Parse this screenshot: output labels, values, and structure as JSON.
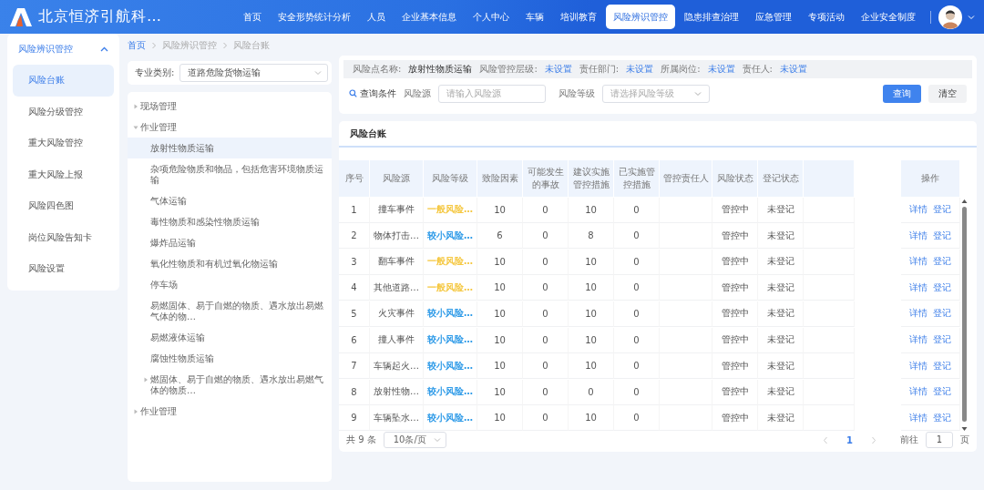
{
  "header": {
    "title": "北京恒济引航科…",
    "nav": [
      {
        "label": "首页",
        "selected": false
      },
      {
        "label": "安全形势统计分析",
        "selected": false
      },
      {
        "label": "人员",
        "selected": false
      },
      {
        "label": "企业基本信息",
        "selected": false
      },
      {
        "label": "个人中心",
        "selected": false
      },
      {
        "label": "车辆",
        "selected": false
      },
      {
        "label": "培训教育",
        "selected": false
      },
      {
        "label": "风险辨识管控",
        "selected": true
      },
      {
        "label": "隐患排查治理",
        "selected": false
      },
      {
        "label": "应急管理",
        "selected": false
      },
      {
        "label": "专项活动",
        "selected": false
      },
      {
        "label": "企业安全制度",
        "selected": false
      }
    ]
  },
  "sidebar": {
    "group": {
      "label": "风险辨识管控",
      "expanded": true
    },
    "items": [
      {
        "label": "风险台账",
        "selected": true
      },
      {
        "label": "风险分级管控",
        "selected": false
      },
      {
        "label": "重大风险管控",
        "selected": false
      },
      {
        "label": "重大风险上报",
        "selected": false
      },
      {
        "label": "风险四色图",
        "selected": false
      },
      {
        "label": "岗位风险告知卡",
        "selected": false
      },
      {
        "label": "风险设置",
        "selected": false
      }
    ]
  },
  "breadcrumb": [
    "首页",
    "风险辨识管控",
    "风险台账"
  ],
  "category": {
    "label": "专业类别:",
    "value": "道路危险货物运输"
  },
  "tree": [
    {
      "label": "现场管理",
      "expanded": false,
      "selected": false
    },
    {
      "label": "作业管理",
      "expanded": true,
      "selected": false,
      "children": [
        {
          "label": "放射性物质运输",
          "selected": true
        },
        {
          "label": "杂项危险物质和物品，包括危害环境物质运输",
          "selected": false
        },
        {
          "label": "气体运输",
          "selected": false
        },
        {
          "label": "毒性物质和感染性物质运输",
          "selected": false
        },
        {
          "label": "爆炸品运输",
          "selected": false
        },
        {
          "label": "氧化性物质和有机过氧化物运输",
          "selected": false
        },
        {
          "label": "停车场",
          "selected": false
        },
        {
          "label": "易燃固体、易于自燃的物质、遇水放出易燃气体的物…",
          "selected": false
        },
        {
          "label": "易燃液体运输",
          "selected": false
        },
        {
          "label": "腐蚀性物质运输",
          "selected": false
        },
        {
          "label": "燃固体、易于自燃的物质、遇水放出易燃气体的物质…",
          "expanded": false,
          "selected": false
        }
      ]
    },
    {
      "label": "作业管理",
      "expanded": false,
      "selected": false
    }
  ],
  "risk_point": [
    {
      "label": "风险点名称:",
      "value": "放射性物质运输",
      "kind": "plain"
    },
    {
      "label": "风险管控层级:",
      "value": "未设置",
      "kind": "unset"
    },
    {
      "label": "责任部门:",
      "value": "未设置",
      "kind": "unset"
    },
    {
      "label": "所属岗位:",
      "value": "未设置",
      "kind": "unset"
    },
    {
      "label": "责任人:",
      "value": "未设置",
      "kind": "unset"
    }
  ],
  "query": {
    "title": "查询条件",
    "fields": [
      {
        "label": "风险源",
        "placeholder": "请输入风险源",
        "kind": "input"
      },
      {
        "label": "风险等级",
        "placeholder": "请选择风险等级",
        "kind": "select"
      }
    ],
    "buttons": [
      {
        "label": "查询",
        "kind": "primary"
      },
      {
        "label": "清空",
        "kind": "default"
      }
    ]
  },
  "ledger": {
    "title": "风险台账",
    "columns": [
      "序号",
      "风险源",
      "风险等级",
      "致险因素",
      "可能发生的事故",
      "建议实施管控措施",
      "已实施管控措施",
      "管控责任人",
      "风险状态",
      "登记状态",
      "操作"
    ],
    "rows": [
      {
        "index": "1",
        "source": "撞车事件",
        "level": {
          "text": "一般风险…",
          "color": "#f5c842"
        },
        "factors": "10",
        "accidents": "0",
        "suggested": "10",
        "implemented": "0",
        "status": "管控中",
        "registered": "未登记",
        "actions": [
          "详情",
          "登记"
        ]
      },
      {
        "index": "2",
        "source": "物体打击…",
        "level": {
          "text": "较小风险…",
          "color": "#2f9be8"
        },
        "factors": "6",
        "accidents": "0",
        "suggested": "8",
        "implemented": "0",
        "status": "管控中",
        "registered": "未登记",
        "actions": [
          "详情",
          "登记"
        ]
      },
      {
        "index": "3",
        "source": "翻车事件",
        "level": {
          "text": "一般风险…",
          "color": "#f5c842"
        },
        "factors": "10",
        "accidents": "0",
        "suggested": "10",
        "implemented": "0",
        "status": "管控中",
        "registered": "未登记",
        "actions": [
          "详情",
          "登记"
        ]
      },
      {
        "index": "4",
        "source": "其他道路…",
        "level": {
          "text": "一般风险…",
          "color": "#f5c842"
        },
        "factors": "10",
        "accidents": "0",
        "suggested": "10",
        "implemented": "0",
        "status": "管控中",
        "registered": "未登记",
        "actions": [
          "详情",
          "登记"
        ]
      },
      {
        "index": "5",
        "source": "火灾事件",
        "level": {
          "text": "较小风险…",
          "color": "#2f9be8"
        },
        "factors": "10",
        "accidents": "0",
        "suggested": "10",
        "implemented": "0",
        "status": "管控中",
        "registered": "未登记",
        "actions": [
          "详情",
          "登记"
        ]
      },
      {
        "index": "6",
        "source": "撞人事件",
        "level": {
          "text": "较小风险…",
          "color": "#2f9be8"
        },
        "factors": "10",
        "accidents": "0",
        "suggested": "10",
        "implemented": "0",
        "status": "管控中",
        "registered": "未登记",
        "actions": [
          "详情",
          "登记"
        ]
      },
      {
        "index": "7",
        "source": "车辆起火…",
        "level": {
          "text": "较小风险…",
          "color": "#2f9be8"
        },
        "factors": "10",
        "accidents": "0",
        "suggested": "10",
        "implemented": "0",
        "status": "管控中",
        "registered": "未登记",
        "actions": [
          "详情",
          "登记"
        ]
      },
      {
        "index": "8",
        "source": "放射性物…",
        "level": {
          "text": "较小风险…",
          "color": "#2f9be8"
        },
        "factors": "10",
        "accidents": "0",
        "suggested": "0",
        "implemented": "0",
        "status": "管控中",
        "registered": "未登记",
        "actions": [
          "详情",
          "登记"
        ]
      },
      {
        "index": "9",
        "source": "车辆坠水…",
        "level": {
          "text": "较小风险…",
          "color": "#2f9be8"
        },
        "factors": "10",
        "accidents": "0",
        "suggested": "10",
        "implemented": "0",
        "status": "管控中",
        "registered": "未登记",
        "actions": [
          "详情",
          "登记"
        ]
      }
    ],
    "pagination": {
      "total": "共 9 条",
      "page_size": "10条/页",
      "pages": [
        {
          "label": "1",
          "selected": true
        }
      ],
      "goto_label": "前往",
      "goto_value": "1",
      "goto_suffix": "页"
    }
  }
}
